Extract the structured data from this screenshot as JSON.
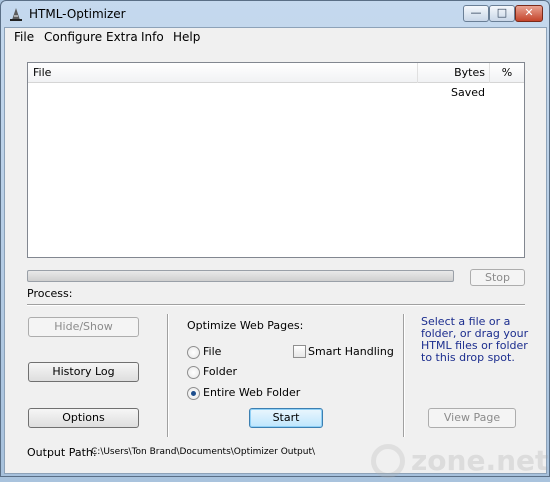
{
  "window": {
    "title": "HTML-Optimizer",
    "min_glyph": "—",
    "max_glyph": "□",
    "close_glyph": "✕"
  },
  "menu": [
    {
      "label": "File"
    },
    {
      "label": "Configure"
    },
    {
      "label": "Extra"
    },
    {
      "label": "Info"
    },
    {
      "label": "Help"
    }
  ],
  "file_list": {
    "columns": [
      "File",
      "Bytes Saved",
      "%"
    ],
    "rows": []
  },
  "progress": {
    "value": 0
  },
  "stop_button": "Stop",
  "process_label": "Process:",
  "left_buttons": {
    "hide_show": "Hide/Show",
    "history_log": "History Log",
    "options": "Options"
  },
  "optimize": {
    "heading": "Optimize Web Pages:",
    "options": [
      {
        "label": "File",
        "checked": false
      },
      {
        "label": "Folder",
        "checked": false
      },
      {
        "label": "Entire Web Folder",
        "checked": true
      }
    ],
    "smart_handling": {
      "label": "Smart Handling",
      "checked": false
    },
    "start_button": "Start"
  },
  "drop_hint": "Select a file or a folder, or drag your HTML files or folder to this drop spot.",
  "view_page_button": "View Page",
  "output": {
    "label": "Output Path:",
    "value": "C:\\Users\\Ton Brand\\Documents\\Optimizer Output\\"
  },
  "watermark": {
    "text": "zone.net"
  }
}
